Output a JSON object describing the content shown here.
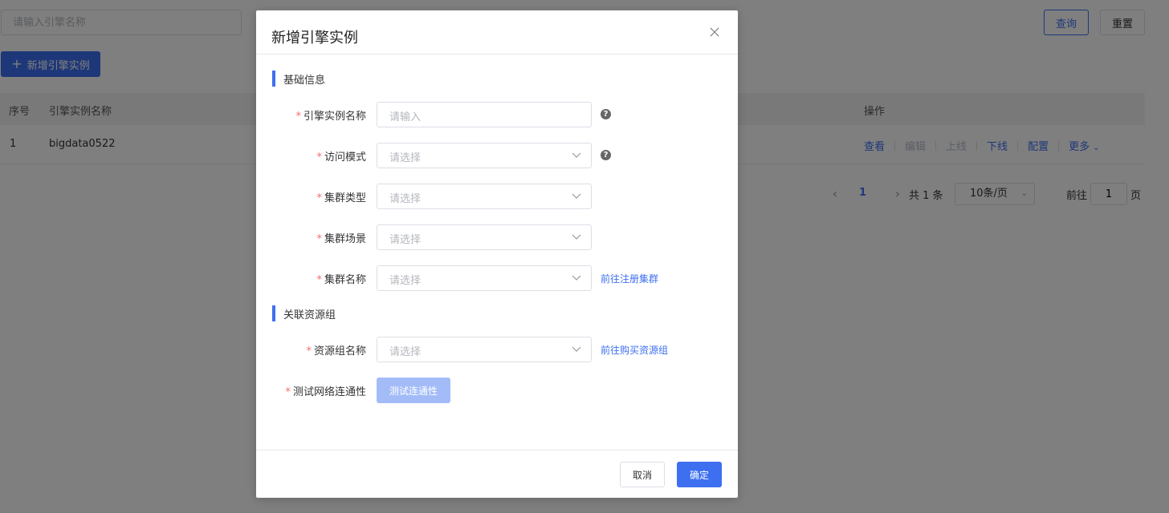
{
  "page": {
    "search": {
      "placeholder": "请输入引擎名称"
    },
    "query_label": "查询",
    "reset_label": "重置",
    "add_label": "新增引擎实例",
    "table": {
      "columns": {
        "index": "序号",
        "name": "引擎实例名称",
        "ops": "操作"
      },
      "rows": [
        {
          "index": "1",
          "name": "bigdata0522",
          "ops": {
            "view": "查看",
            "edit": "编辑",
            "online": "上线",
            "offline": "下线",
            "config": "配置",
            "more": "更多"
          }
        }
      ]
    },
    "pagination": {
      "current": "1",
      "total": "共 1 条",
      "page_size": "10条/页",
      "goto_label": "前往",
      "goto_value": "1",
      "goto_unit": "页"
    }
  },
  "dialog": {
    "title": "新增引擎实例",
    "sections": {
      "basic": "基础信息",
      "resource": "关联资源组"
    },
    "fields": {
      "engine_name": {
        "label": "引擎实例名称",
        "placeholder": "请输入"
      },
      "access_mode": {
        "label": "访问模式",
        "placeholder": "请选择"
      },
      "cluster_type": {
        "label": "集群类型",
        "placeholder": "请选择"
      },
      "cluster_scene": {
        "label": "集群场景",
        "placeholder": "请选择"
      },
      "cluster_name": {
        "label": "集群名称",
        "placeholder": "请选择",
        "link": "前往注册集群"
      },
      "resource_group": {
        "label": "资源组名称",
        "placeholder": "请选择",
        "link": "前往购买资源组"
      },
      "network_test": {
        "label": "测试网络连通性",
        "button": "测试连通性"
      }
    },
    "required_mark": "*",
    "help_mark": "?",
    "cancel_label": "取消",
    "ok_label": "确定"
  },
  "colors": {
    "primary": "#3d6ff0",
    "required": "#f56c6c",
    "disabled_button": "#a3bcf8"
  }
}
